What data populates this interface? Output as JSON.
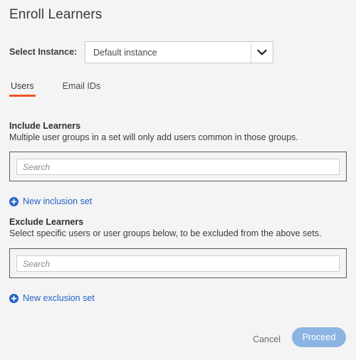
{
  "header": {
    "title": "Enroll Learners"
  },
  "instance": {
    "label": "Select Instance:",
    "selected": "Default instance",
    "options": [
      "Default instance"
    ],
    "arrow_icon": "chevron-down-icon"
  },
  "tabs": [
    {
      "label": "Users",
      "active": true
    },
    {
      "label": "Email IDs",
      "active": false
    }
  ],
  "include": {
    "title": "Include Learners",
    "description": "Multiple user groups in a set will only add users common in those groups.",
    "search": {
      "value": "",
      "placeholder": "Search"
    },
    "add_link": {
      "label": "New inclusion set",
      "icon": "plus-circle-icon"
    }
  },
  "exclude": {
    "title": "Exclude Learners",
    "description": "Select specific users or user groups below, to be excluded from the above sets.",
    "search": {
      "value": "",
      "placeholder": "Search"
    },
    "add_link": {
      "label": "New exclusion set",
      "icon": "plus-circle-icon"
    }
  },
  "footer": {
    "cancel_label": "Cancel",
    "proceed_label": "Proceed"
  },
  "colors": {
    "background": "#f4f4f4",
    "tab_active_underline": "#f0552a",
    "link_blue": "#2462c9",
    "proceed_button": "#8cb4e3",
    "text_primary": "#3c3c3c",
    "text_muted": "#6d6d6d"
  }
}
